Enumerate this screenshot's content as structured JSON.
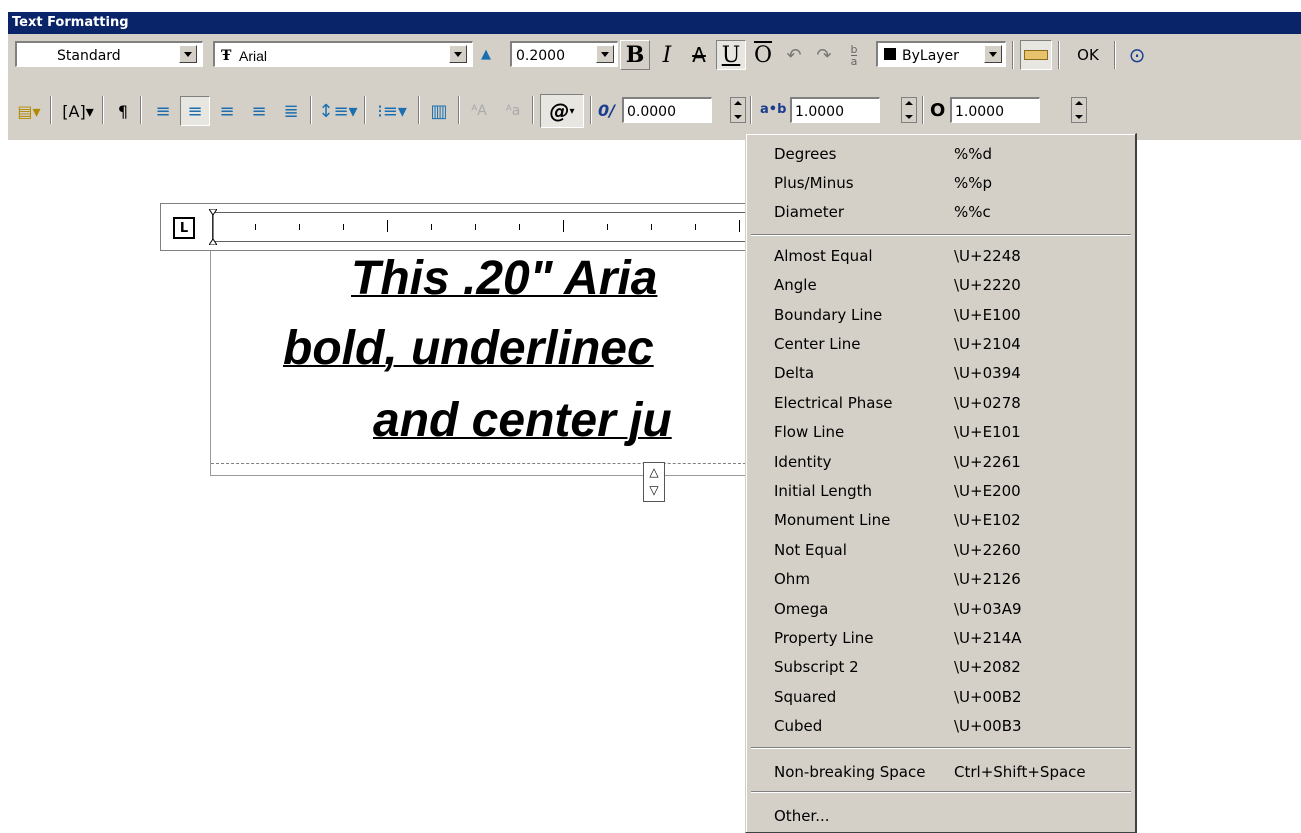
{
  "window": {
    "title": "Text Formatting"
  },
  "toolbar1": {
    "style_value": "Standard",
    "font_value": "Arial",
    "font_glyph": "Ŧ",
    "annotative_glyph": "▲",
    "height_value": "0.2000",
    "bold_label": "B",
    "italic_label": "I",
    "strike_label": "A",
    "underline_label": "U",
    "overline_label": "O",
    "undo_glyph": "↶",
    "redo_glyph": "↷",
    "stack_top": "b",
    "stack_bottom": "a",
    "color_value": "ByLayer",
    "ok_label": "OK",
    "options_glyph": "⊙"
  },
  "toolbar2": {
    "symbol_label": "@",
    "oblique_glyph": "0/",
    "oblique_value": "0.0000",
    "tracking_glyph": "a•b",
    "tracking_value": "1.0000",
    "width_glyph": "O",
    "width_value": "1.0000"
  },
  "ruler": {
    "tab_glyph": "L"
  },
  "editor": {
    "lines": [
      "This .20\" Aria",
      "bold, underlinec",
      "and center ju"
    ]
  },
  "symbol_menu": {
    "group1": [
      {
        "label": "Degrees",
        "code": "%%d"
      },
      {
        "label": "Plus/Minus",
        "code": "%%p"
      },
      {
        "label": "Diameter",
        "code": "%%c"
      }
    ],
    "group2": [
      {
        "label": "Almost Equal",
        "code": "\\U+2248"
      },
      {
        "label": "Angle",
        "code": "\\U+2220"
      },
      {
        "label": "Boundary Line",
        "code": "\\U+E100"
      },
      {
        "label": "Center Line",
        "code": "\\U+2104"
      },
      {
        "label": "Delta",
        "code": "\\U+0394"
      },
      {
        "label": "Electrical Phase",
        "code": "\\U+0278"
      },
      {
        "label": "Flow Line",
        "code": "\\U+E101"
      },
      {
        "label": "Identity",
        "code": "\\U+2261"
      },
      {
        "label": "Initial Length",
        "code": "\\U+E200"
      },
      {
        "label": "Monument Line",
        "code": "\\U+E102"
      },
      {
        "label": "Not Equal",
        "code": "\\U+2260"
      },
      {
        "label": "Ohm",
        "code": "\\U+2126"
      },
      {
        "label": "Omega",
        "code": "\\U+03A9"
      },
      {
        "label": "Property Line",
        "code": "\\U+214A"
      },
      {
        "label": "Subscript 2",
        "code": "\\U+2082"
      },
      {
        "label": "Squared",
        "code": "\\U+00B2"
      },
      {
        "label": "Cubed",
        "code": "\\U+00B3"
      }
    ],
    "group3": [
      {
        "label": "Non-breaking Space",
        "code": "Ctrl+Shift+Space"
      }
    ],
    "group4": [
      {
        "label": "Other...",
        "code": ""
      }
    ]
  },
  "colors": {
    "titlebar": "#0a246a",
    "face": "#d4d0c8"
  }
}
